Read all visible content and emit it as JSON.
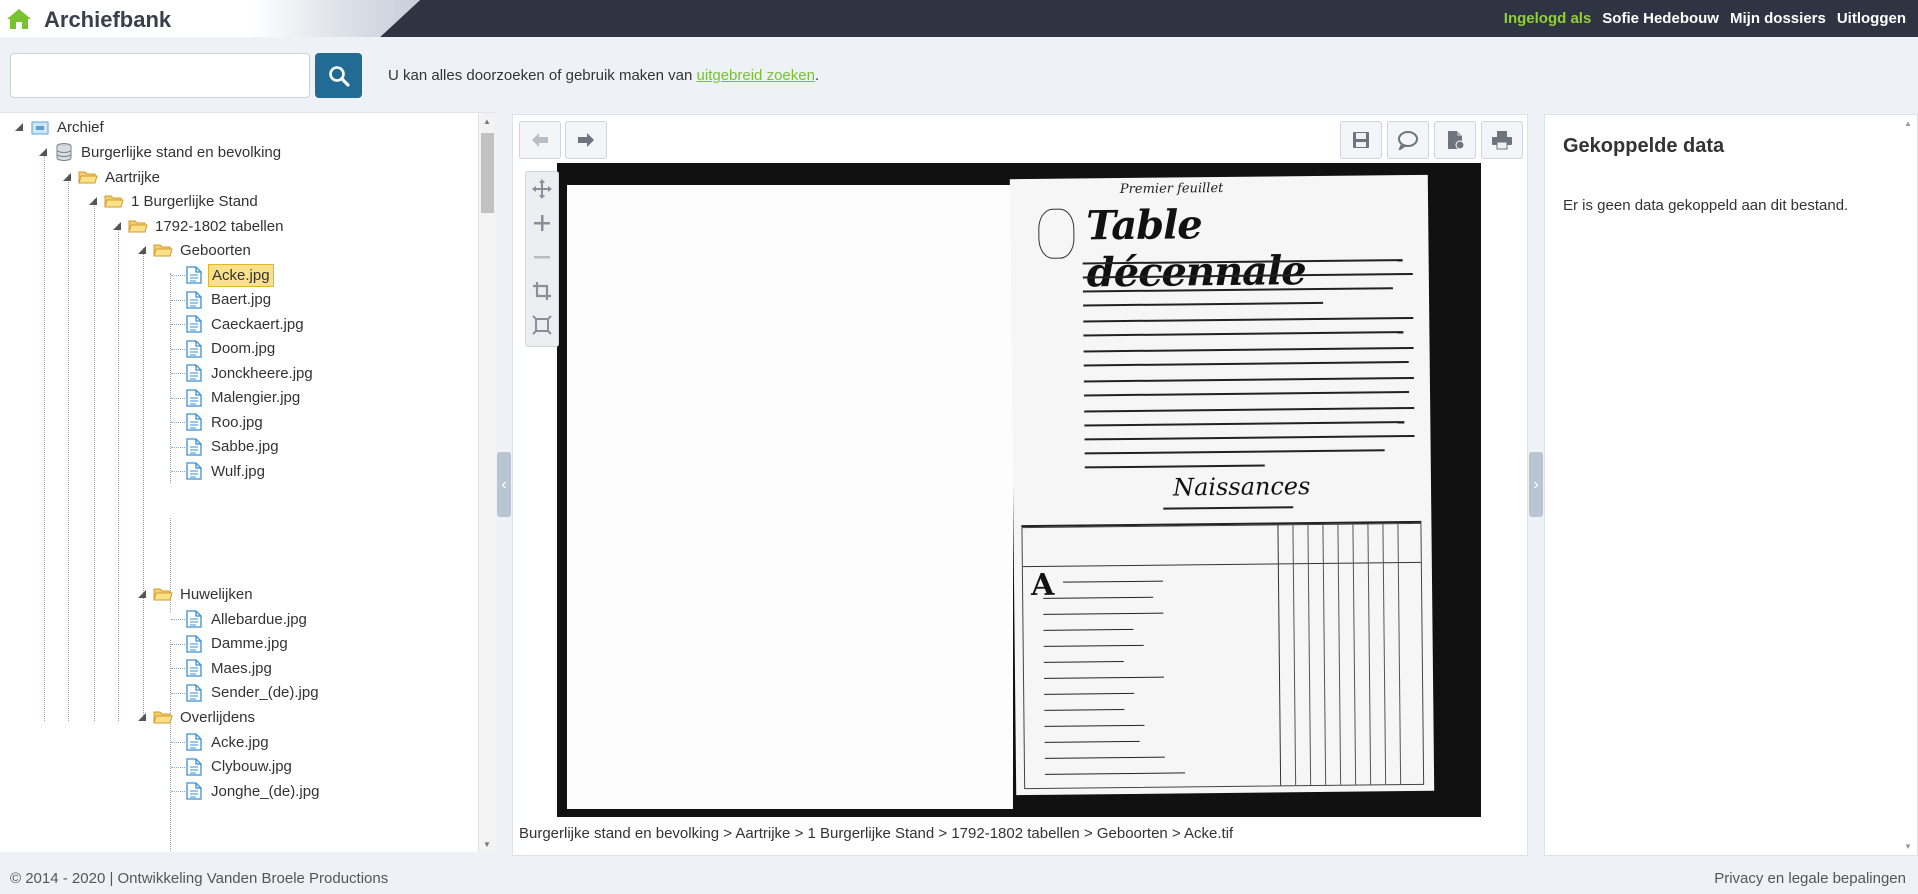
{
  "header": {
    "title": "Archiefbank",
    "logged_in_as": "Ingelogd als",
    "user_name": "Sofie Hedebouw",
    "my_files": "Mijn dossiers",
    "logout": "Uitloggen"
  },
  "search": {
    "placeholder": "",
    "hint_prefix": "U kan alles doorzoeken of gebruik maken van ",
    "hint_link": "uitgebreid zoeken",
    "hint_suffix": "."
  },
  "tree": {
    "root": "Archief",
    "level1": "Burgerlijke stand en bevolking",
    "level2": "Aartrijke",
    "level3": "1 Burgerlijke Stand",
    "level4": "1792-1802 tabellen",
    "folder_births": "Geboorten",
    "births": [
      "Acke.jpg",
      "Baert.jpg",
      "Caeckaert.jpg",
      "Doom.jpg",
      "Jonckheere.jpg",
      "Malengier.jpg",
      "Roo.jpg",
      "Sabbe.jpg",
      "Wulf.jpg"
    ],
    "folder_marriages": "Huwelijken",
    "marriages": [
      "Allebardue.jpg",
      "Damme.jpg",
      "Maes.jpg",
      "Sender_(de).jpg"
    ],
    "folder_deaths": "Overlijdens",
    "deaths": [
      "Acke.jpg",
      "Clybouw.jpg",
      "Jonghe_(de).jpg"
    ]
  },
  "viewer": {
    "breadcrumb": "Burgerlijke stand en bevolking > Aartrijke > 1 Burgerlijke Stand > 1792-1802 tabellen > Geboorten > Acke.tif",
    "doc_heading": "Table décennale",
    "doc_subheading": "Naissances",
    "doc_top": "Premier feuillet"
  },
  "linked_data": {
    "title": "Gekoppelde data",
    "empty_message": "Er is geen data gekoppeld aan dit bestand."
  },
  "footer": {
    "copyright": "© 2014 - 2020 | Ontwikkeling",
    "company": "Vanden Broele Productions",
    "privacy": "Privacy en legale bepalingen"
  },
  "colors": {
    "topbar": "#2f3442",
    "accent_green": "#8fd134",
    "search_button": "#226b95",
    "selected_highlight": "#fbe08a"
  }
}
